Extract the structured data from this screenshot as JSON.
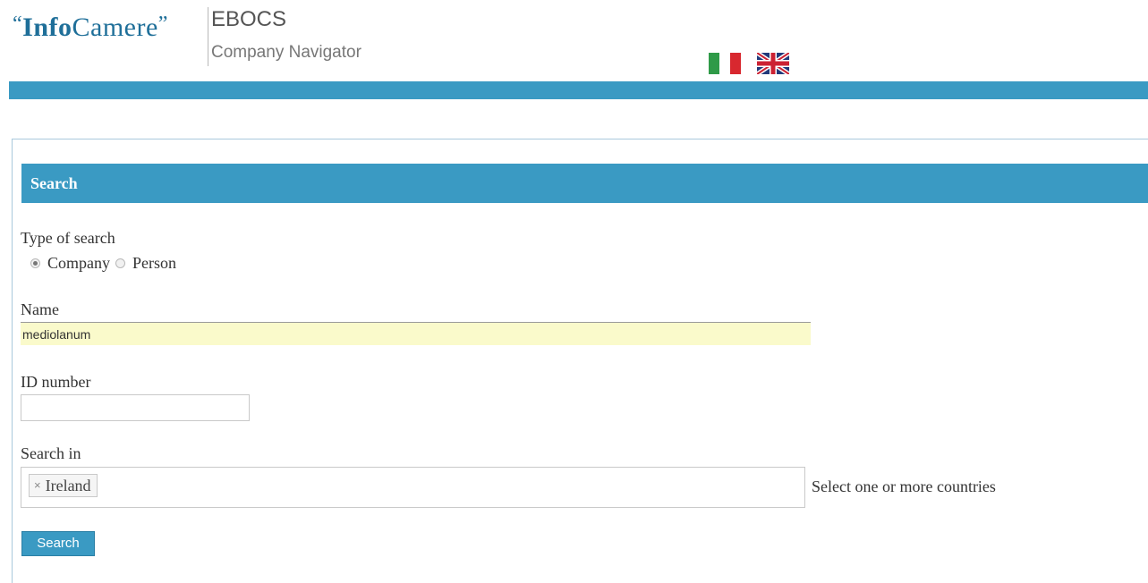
{
  "header": {
    "logo_text_open_quote": "“",
    "logo_text_info": "Info",
    "logo_text_camere": "Camere",
    "logo_text_close_quote": "”",
    "app_title": "EBOCS",
    "app_subtitle": "Company Navigator",
    "languages": [
      {
        "name": "Italian",
        "icon": "italy-flag-icon"
      },
      {
        "name": "English",
        "icon": "uk-flag-icon"
      }
    ],
    "band_color": "#3a9ac3"
  },
  "search_panel": {
    "title": "Search",
    "type_of_search": {
      "label": "Type of search",
      "options": [
        {
          "label": "Company",
          "selected": true
        },
        {
          "label": "Person",
          "selected": false
        }
      ]
    },
    "name": {
      "label": "Name",
      "value": "mediolanum"
    },
    "id_number": {
      "label": "ID number",
      "value": ""
    },
    "search_in": {
      "label": "Search in",
      "selected_countries": [
        "Ireland"
      ],
      "chip_remove_glyph": "×",
      "help_text": "Select one or more countries"
    },
    "submit_label": "Search"
  },
  "colors": {
    "accent": "#3a9ac3",
    "name_field_bg": "#fafacb"
  }
}
